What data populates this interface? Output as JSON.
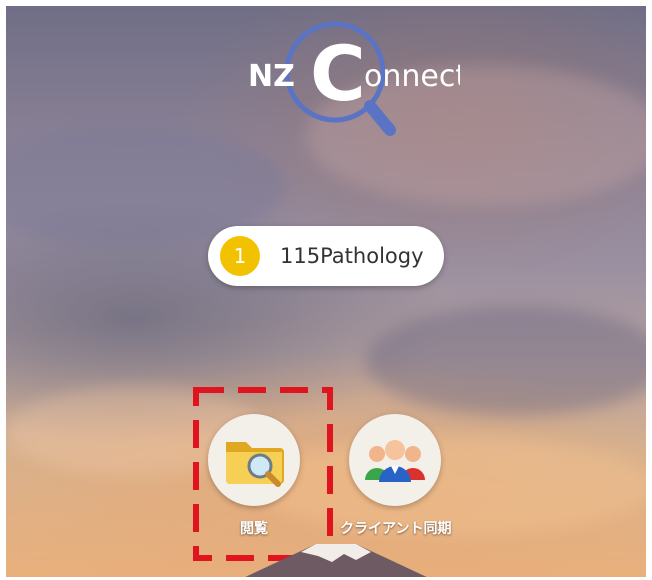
{
  "logo": {
    "text_left": "NZ",
    "text_right": "onnect",
    "letter": "C",
    "ring_color": "#5b73c4"
  },
  "user": {
    "badge": "1",
    "name": "115Pathology"
  },
  "apps": [
    {
      "label": "閲覧",
      "icon": "folder-search-icon"
    },
    {
      "label": "クライアント同期",
      "icon": "people-group-icon"
    }
  ],
  "highlight": {
    "color": "#e0141e",
    "style": "dashed"
  }
}
